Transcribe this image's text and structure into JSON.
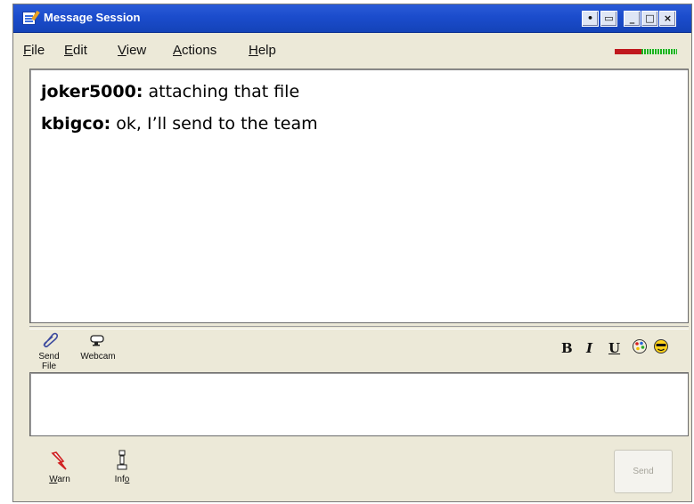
{
  "window": {
    "title": "Message Session",
    "controls": {
      "pin": "•",
      "restore": "▭",
      "minimize": "_",
      "maximize": "□",
      "close": "×"
    }
  },
  "menu": [
    {
      "label": "File",
      "accel": "F",
      "rest": "ile"
    },
    {
      "label": "Edit",
      "accel": "E",
      "rest": "dit"
    },
    {
      "label": "View",
      "accel": "V",
      "rest": "iew"
    },
    {
      "label": "Actions",
      "accel": "A",
      "rest": "ctions"
    },
    {
      "label": "Help",
      "accel": "H",
      "rest": "elp"
    }
  ],
  "history": {
    "messages": [
      {
        "sender": "joker5000:",
        "text": " attaching that file"
      },
      {
        "sender": "kbigco:",
        "text": " ok, I’ll send to the team"
      }
    ]
  },
  "toolbar": {
    "send_file_label": "Send File",
    "webcam_label": "Webcam",
    "bold": "B",
    "italic": "I",
    "underline": "U"
  },
  "input": {
    "value": ""
  },
  "bottom": {
    "warn_label": "Warn",
    "info_label": "Info",
    "send_label": "Send"
  },
  "colors": {
    "titlebar": "#1b4ccc",
    "window_bg": "#ece9d8",
    "signal_red": "#c0181e",
    "signal_green": "#1db31d"
  }
}
